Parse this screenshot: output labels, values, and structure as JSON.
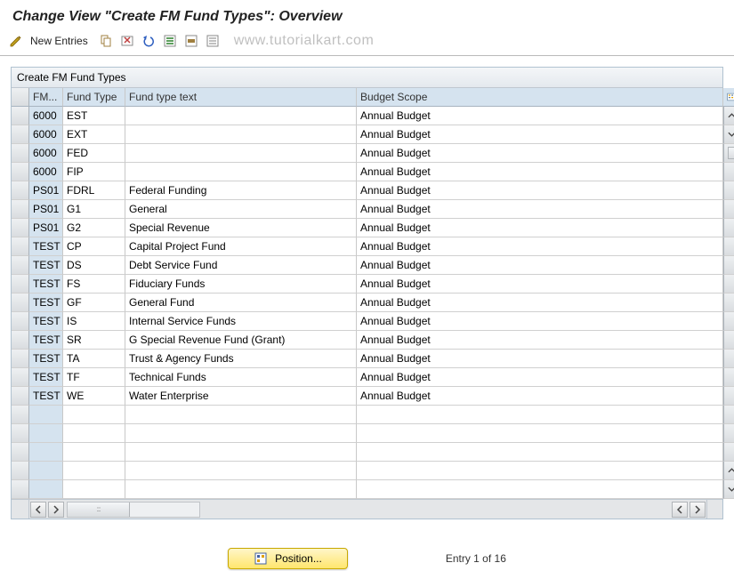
{
  "page_title": "Change View \"Create FM Fund Types\": Overview",
  "toolbar": {
    "new_entries": "New Entries"
  },
  "watermark": "www.tutorialkart.com",
  "table": {
    "caption": "Create FM Fund Types",
    "columns": {
      "fm": "FM...",
      "fund_type": "Fund Type",
      "fund_type_text": "Fund type text",
      "budget_scope": "Budget Scope"
    },
    "rows": [
      {
        "fm": "6000",
        "fund_type": "EST",
        "fund_type_text": "",
        "budget_scope": "Annual Budget"
      },
      {
        "fm": "6000",
        "fund_type": "EXT",
        "fund_type_text": "",
        "budget_scope": "Annual Budget"
      },
      {
        "fm": "6000",
        "fund_type": "FED",
        "fund_type_text": "",
        "budget_scope": "Annual Budget"
      },
      {
        "fm": "6000",
        "fund_type": "FIP",
        "fund_type_text": "",
        "budget_scope": "Annual Budget"
      },
      {
        "fm": "PS01",
        "fund_type": "FDRL",
        "fund_type_text": "Federal Funding",
        "budget_scope": "Annual Budget"
      },
      {
        "fm": "PS01",
        "fund_type": "G1",
        "fund_type_text": "General",
        "budget_scope": "Annual Budget"
      },
      {
        "fm": "PS01",
        "fund_type": "G2",
        "fund_type_text": "Special Revenue",
        "budget_scope": "Annual Budget"
      },
      {
        "fm": "TEST",
        "fund_type": "CP",
        "fund_type_text": "Capital Project Fund",
        "budget_scope": "Annual Budget"
      },
      {
        "fm": "TEST",
        "fund_type": "DS",
        "fund_type_text": "Debt Service Fund",
        "budget_scope": "Annual Budget"
      },
      {
        "fm": "TEST",
        "fund_type": "FS",
        "fund_type_text": "Fiduciary Funds",
        "budget_scope": "Annual Budget"
      },
      {
        "fm": "TEST",
        "fund_type": "GF",
        "fund_type_text": "General Fund",
        "budget_scope": "Annual Budget"
      },
      {
        "fm": "TEST",
        "fund_type": "IS",
        "fund_type_text": "Internal Service Funds",
        "budget_scope": "Annual Budget"
      },
      {
        "fm": "TEST",
        "fund_type": "SR",
        "fund_type_text": "G Special Revenue Fund (Grant)",
        "budget_scope": "Annual Budget"
      },
      {
        "fm": "TEST",
        "fund_type": "TA",
        "fund_type_text": "Trust & Agency Funds",
        "budget_scope": "Annual Budget"
      },
      {
        "fm": "TEST",
        "fund_type": "TF",
        "fund_type_text": "Technical Funds",
        "budget_scope": "Annual Budget"
      },
      {
        "fm": "TEST",
        "fund_type": "WE",
        "fund_type_text": "Water Enterprise",
        "budget_scope": "Annual Budget"
      }
    ],
    "empty_rows": 5
  },
  "footer": {
    "position_button": "Position...",
    "entry_text": "Entry 1 of 16"
  }
}
